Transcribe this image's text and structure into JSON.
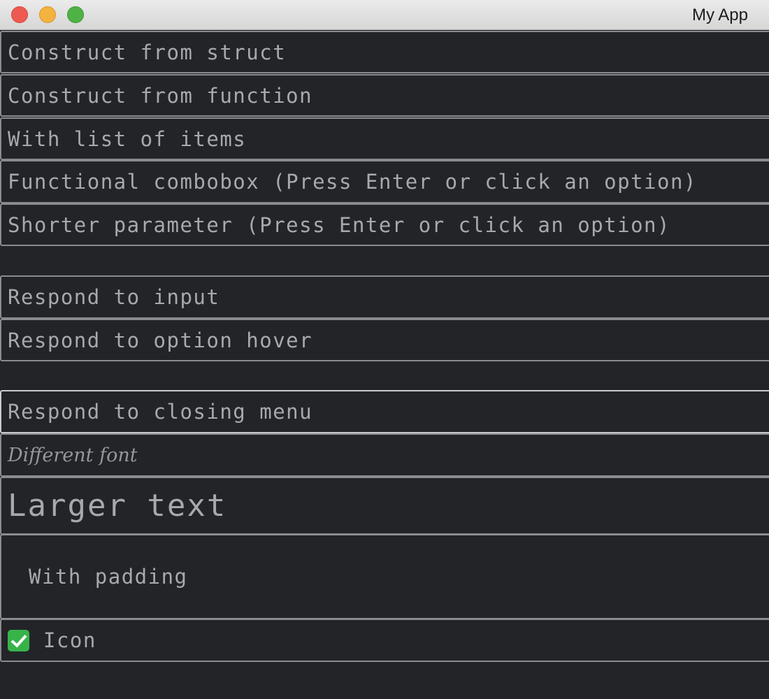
{
  "window": {
    "title": "My App"
  },
  "combos": [
    {
      "label": "Construct from struct"
    },
    {
      "label": "Construct from function"
    },
    {
      "label": "With list of items"
    },
    {
      "label": "Functional combobox (Press Enter or click an option)"
    },
    {
      "label": "Shorter parameter (Press Enter or click an option)"
    },
    {
      "label": "Respond to input"
    },
    {
      "label": "Respond to option hover"
    },
    {
      "label": "Respond to closing menu"
    },
    {
      "label": "Different font"
    },
    {
      "label": "Larger text"
    },
    {
      "label": "With padding"
    },
    {
      "label": "Icon",
      "icon": "check-mark-icon"
    }
  ],
  "colors": {
    "background": "#232428",
    "text": "#a8a9ad",
    "border": "#8a8b8f",
    "icon_green": "#37b34a"
  }
}
